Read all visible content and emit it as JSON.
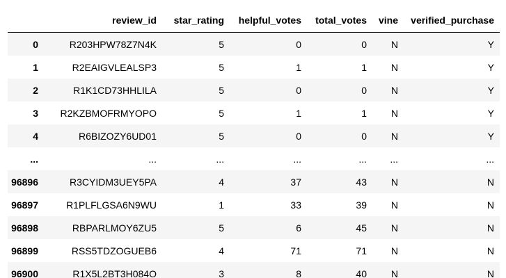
{
  "columns": {
    "index": "",
    "review_id": "review_id",
    "star_rating": "star_rating",
    "helpful_votes": "helpful_votes",
    "total_votes": "total_votes",
    "vine": "vine",
    "verified_purchase": "verified_purchase"
  },
  "rows": [
    {
      "index": "0",
      "review_id": "R203HPW78Z7N4K",
      "star_rating": "5",
      "helpful_votes": "0",
      "total_votes": "0",
      "vine": "N",
      "verified_purchase": "Y"
    },
    {
      "index": "1",
      "review_id": "R2EAIGVLEALSP3",
      "star_rating": "5",
      "helpful_votes": "1",
      "total_votes": "1",
      "vine": "N",
      "verified_purchase": "Y"
    },
    {
      "index": "2",
      "review_id": "R1K1CD73HHLILA",
      "star_rating": "5",
      "helpful_votes": "0",
      "total_votes": "0",
      "vine": "N",
      "verified_purchase": "Y"
    },
    {
      "index": "3",
      "review_id": "R2KZBMOFRMYOPO",
      "star_rating": "5",
      "helpful_votes": "1",
      "total_votes": "1",
      "vine": "N",
      "verified_purchase": "Y"
    },
    {
      "index": "4",
      "review_id": "R6BIZOZY6UD01",
      "star_rating": "5",
      "helpful_votes": "0",
      "total_votes": "0",
      "vine": "N",
      "verified_purchase": "Y"
    },
    {
      "index": "...",
      "review_id": "...",
      "star_rating": "...",
      "helpful_votes": "...",
      "total_votes": "...",
      "vine": "...",
      "verified_purchase": "..."
    },
    {
      "index": "96896",
      "review_id": "R3CYIDM3UEY5PA",
      "star_rating": "4",
      "helpful_votes": "37",
      "total_votes": "43",
      "vine": "N",
      "verified_purchase": "N"
    },
    {
      "index": "96897",
      "review_id": "R1PLFLGSA6N9WU",
      "star_rating": "1",
      "helpful_votes": "33",
      "total_votes": "39",
      "vine": "N",
      "verified_purchase": "N"
    },
    {
      "index": "96898",
      "review_id": "RBPARLMOY6ZU5",
      "star_rating": "5",
      "helpful_votes": "6",
      "total_votes": "45",
      "vine": "N",
      "verified_purchase": "N"
    },
    {
      "index": "96899",
      "review_id": "RSS5TDZOGUEB6",
      "star_rating": "4",
      "helpful_votes": "71",
      "total_votes": "71",
      "vine": "N",
      "verified_purchase": "N"
    },
    {
      "index": "96900",
      "review_id": "R1X5L2BT3H084O",
      "star_rating": "3",
      "helpful_votes": "8",
      "total_votes": "40",
      "vine": "N",
      "verified_purchase": "N"
    }
  ]
}
